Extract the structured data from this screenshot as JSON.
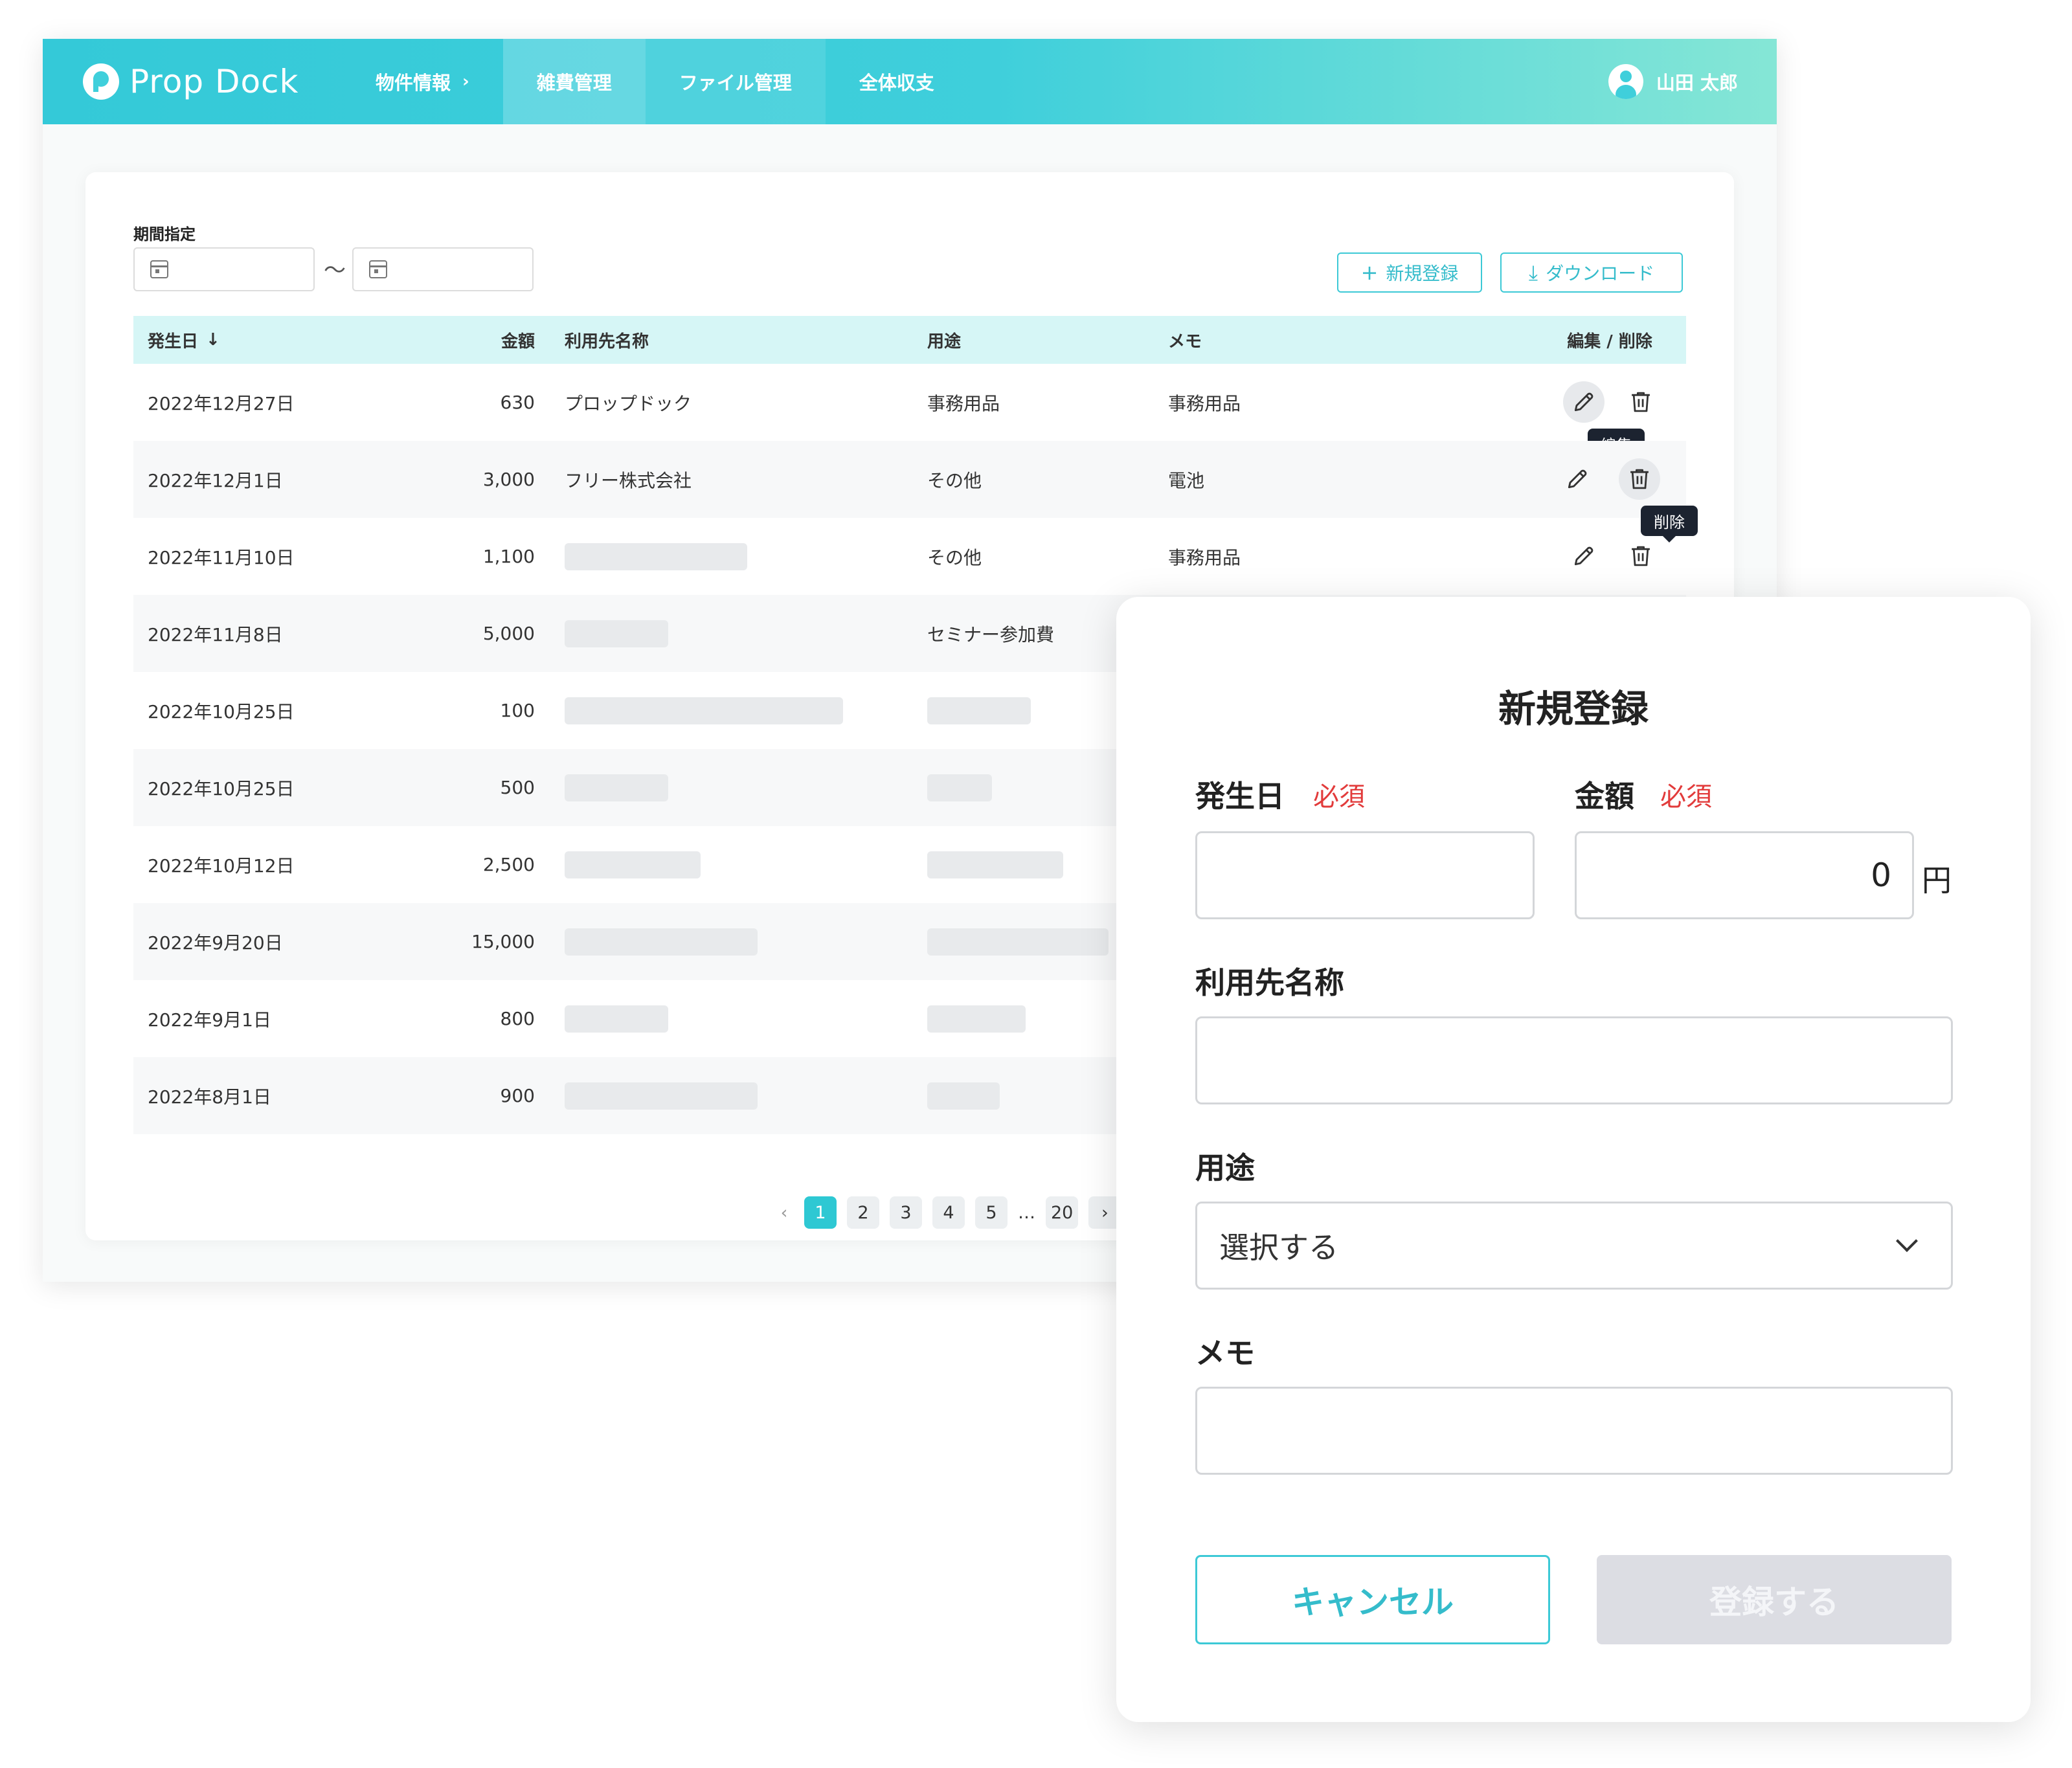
{
  "header": {
    "brand": "Prop Dock",
    "nav": [
      {
        "label": "物件情報",
        "chevron": "›"
      },
      {
        "label": "雑費管理"
      },
      {
        "label": "ファイル管理"
      },
      {
        "label": "全体収支"
      }
    ],
    "user": "山田 太郎"
  },
  "filter": {
    "period_label": "期間指定",
    "separator": "〜"
  },
  "actions": {
    "new_label": "新規登録",
    "download_label": "ダウンロード",
    "new_icon": "+",
    "download_icon": "⤓"
  },
  "table": {
    "columns": {
      "date": "発生日",
      "amount": "金額",
      "name": "利用先名称",
      "use": "用途",
      "memo": "メモ",
      "actions": "編集 / 削除"
    },
    "sort_icon": "↓",
    "rows": [
      {
        "date": "2022年12月27日",
        "amount": "630",
        "name": "プロップドック",
        "use": "事務用品",
        "memo": "事務用品"
      },
      {
        "date": "2022年12月1日",
        "amount": "3,000",
        "name": "フリー株式会社",
        "use": "その他",
        "memo": "電池"
      },
      {
        "date": "2022年11月10日",
        "amount": "1,100",
        "name": "",
        "use": "その他",
        "memo": "事務用品"
      },
      {
        "date": "2022年11月8日",
        "amount": "5,000",
        "name": "",
        "use": "セミナー参加費",
        "memo": ""
      },
      {
        "date": "2022年10月25日",
        "amount": "100",
        "name": "",
        "use": "",
        "memo": ""
      },
      {
        "date": "2022年10月25日",
        "amount": "500",
        "name": "",
        "use": "",
        "memo": ""
      },
      {
        "date": "2022年10月12日",
        "amount": "2,500",
        "name": "",
        "use": "",
        "memo": ""
      },
      {
        "date": "2022年9月20日",
        "amount": "15,000",
        "name": "",
        "use": "",
        "memo": ""
      },
      {
        "date": "2022年9月1日",
        "amount": "800",
        "name": "",
        "use": "",
        "memo": ""
      },
      {
        "date": "2022年8月1日",
        "amount": "900",
        "name": "",
        "use": "",
        "memo": ""
      }
    ],
    "tooltip_edit": "編集",
    "tooltip_delete": "削除"
  },
  "pagination": {
    "prev": "‹",
    "pages": [
      "1",
      "2",
      "3",
      "4",
      "5"
    ],
    "ellipsis": "…",
    "last": "20",
    "next": "›",
    "current": "1"
  },
  "modal": {
    "title": "新規登録",
    "date_label": "発生日",
    "required": "必須",
    "amount_label": "金額",
    "amount_value": "0",
    "currency": "円",
    "name_label": "利用先名称",
    "use_label": "用途",
    "use_placeholder": "選択する",
    "memo_label": "メモ",
    "cancel_label": "キャンセル",
    "submit_label": "登録する"
  }
}
